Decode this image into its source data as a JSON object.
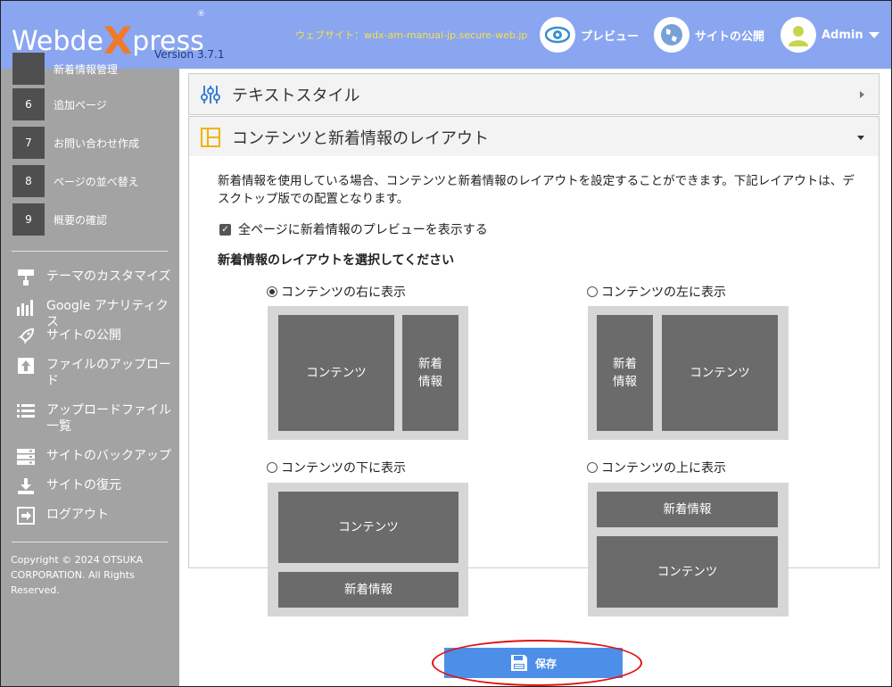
{
  "header": {
    "logo_prefix": "Webde",
    "logo_x": "X",
    "logo_suffix": "press",
    "logo_reg": "®",
    "version": "Version 3.7.1",
    "website": "ウェブサイト：wdx-am-manual-jp.secure-web.jp",
    "preview_label": "プレビュー",
    "publish_label": "サイトの公開",
    "admin_label": "Admin"
  },
  "sidebar": {
    "partial_step_label": "新着情報管理",
    "steps": [
      {
        "num": "6",
        "label": "追加ページ"
      },
      {
        "num": "7",
        "label": "お問い合わせ作成"
      },
      {
        "num": "8",
        "label": "ページの並べ替え"
      },
      {
        "num": "9",
        "label": "概要の確認"
      }
    ],
    "menu": [
      {
        "label": "テーマのカスタマイズ",
        "icon": "paint-roller-icon"
      },
      {
        "label": "Google アナリティクス",
        "icon": "bar-chart-icon"
      },
      {
        "label": "サイトの公開",
        "icon": "rocket-icon"
      },
      {
        "label": "ファイルのアップロード",
        "icon": "upload-icon"
      },
      {
        "label": "アップロードファイル一覧",
        "icon": "list-icon"
      },
      {
        "label": "サイトのバックアップ",
        "icon": "server-icon"
      },
      {
        "label": "サイトの復元",
        "icon": "download-icon"
      },
      {
        "label": "ログアウト",
        "icon": "logout-icon"
      }
    ],
    "copyright": "Copyright © 2024 OTSUKA CORPORATION. All Rights Reserved."
  },
  "main": {
    "text_style_title": "テキストスタイル",
    "layout_title": "コンテンツと新着情報のレイアウト",
    "description": "新着情報を使用している場合、コンテンツと新着情報のレイアウトを設定することができます。下記レイアウトは、デスクトップ版での配置となります。",
    "checkbox_label": "全ページに新着情報のプレビューを表示する",
    "checkbox_checked": true,
    "subheading": "新着情報のレイアウトを選択してください",
    "options": [
      {
        "label": "コンテンツの右に表示",
        "selected": true
      },
      {
        "label": "コンテンツの左に表示",
        "selected": false
      },
      {
        "label": "コンテンツの下に表示",
        "selected": false
      },
      {
        "label": "コンテンツの上に表示",
        "selected": false
      }
    ],
    "block_contents": "コンテンツ",
    "block_news_line1": "新着",
    "block_news_line2": "情報",
    "block_news": "新着情報",
    "save_label": "保存"
  },
  "colors": {
    "header_bg": "#8aa6f0",
    "sidebar_bg": "#a3a3a3",
    "save_button": "#4d8fe8",
    "highlight": "#e01414"
  }
}
